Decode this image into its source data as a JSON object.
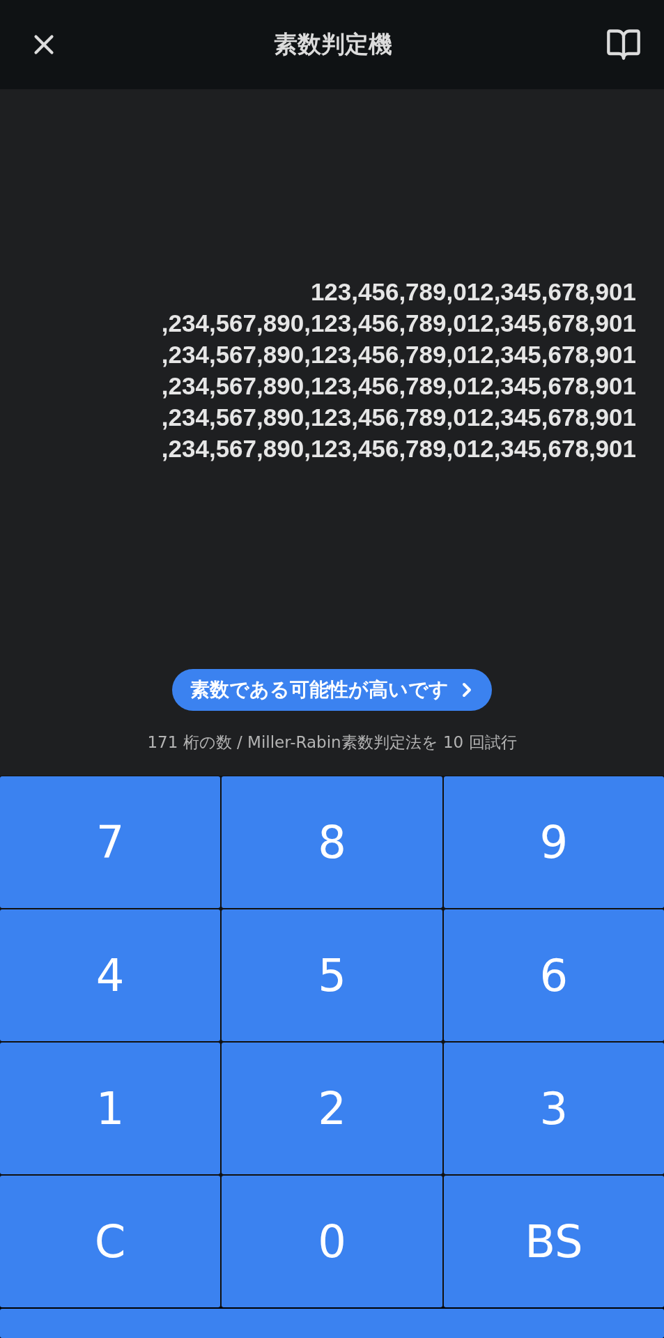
{
  "header": {
    "title": "素数判定機"
  },
  "number_lines": [
    "123,456,789,012,345,678,901",
    ",234,567,890,123,456,789,012,345,678,901",
    ",234,567,890,123,456,789,012,345,678,901",
    ",234,567,890,123,456,789,012,345,678,901",
    ",234,567,890,123,456,789,012,345,678,901",
    ",234,567,890,123,456,789,012,345,678,901"
  ],
  "result_button": {
    "label": "素数である可能性が高いです"
  },
  "caption": "171 桁の数 / Miller-Rabin素数判定法を 10 回試行",
  "keypad": [
    [
      "7",
      "8",
      "9"
    ],
    [
      "4",
      "5",
      "6"
    ],
    [
      "1",
      "2",
      "3"
    ],
    [
      "C",
      "0",
      "BS"
    ]
  ]
}
